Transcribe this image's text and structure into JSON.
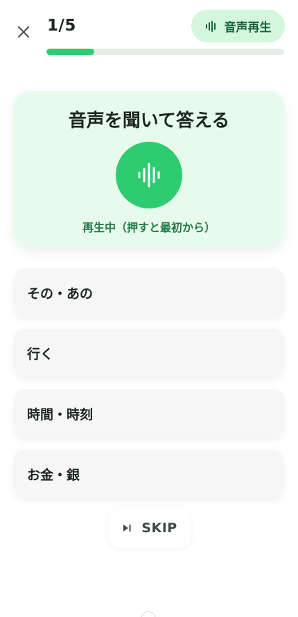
{
  "header": {
    "progress_text": "1/5",
    "progress_fraction": 0.2,
    "audio_button_label": "音声再生"
  },
  "prompt": {
    "title": "音声を聞いて答える",
    "status": "再生中（押すと最初から）"
  },
  "options": [
    {
      "label": "その・あの"
    },
    {
      "label": "行く"
    },
    {
      "label": "時間・時刻"
    },
    {
      "label": "お金・銀"
    }
  ],
  "skip": {
    "label": "SKIP"
  },
  "colors": {
    "accent": "#2ecc71",
    "accent_soft": "#d3f6dd",
    "card_bg": "#e7fbec",
    "status_text": "#1f7a45"
  },
  "icons": {
    "close": "close-icon",
    "audio": "audio-wave-icon",
    "play": "audio-wave-icon",
    "skip": "skip-next-icon"
  }
}
